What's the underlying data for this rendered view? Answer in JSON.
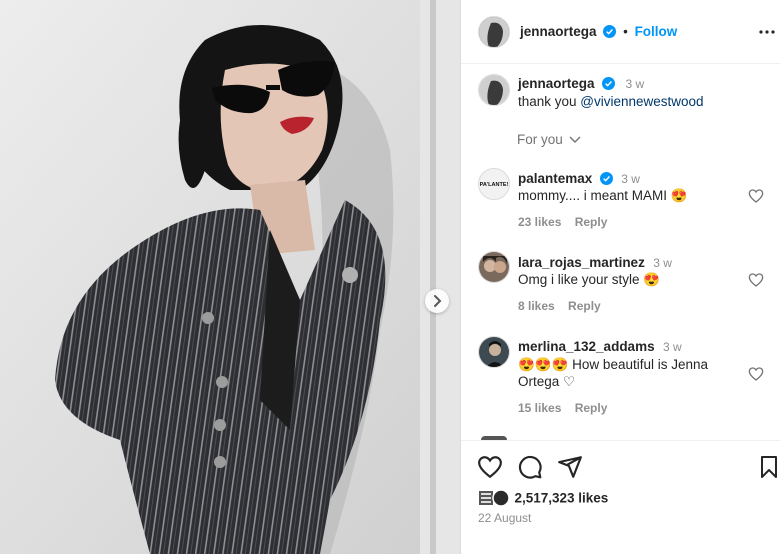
{
  "post": {
    "image_alt": "Woman in striped blazer and black sunglasses",
    "author": "jennaortega",
    "follow_label": "Follow",
    "dot": "•"
  },
  "caption": {
    "username": "jennaortega",
    "time": "3 w",
    "text": "thank you ",
    "mention": "@viviennewestwood"
  },
  "for_you_label": "For you",
  "comments": [
    {
      "username": "palantemax",
      "verified": true,
      "time": "3 w",
      "text": "mommy.... i meant MAMI 😍",
      "likes": "23 likes",
      "reply": "Reply"
    },
    {
      "username": "lara_rojas_martinez",
      "verified": false,
      "time": "3 w",
      "text": "Omg i like your style 😍",
      "likes": "8 likes",
      "reply": "Reply"
    },
    {
      "username": "merlina_132_addams",
      "verified": false,
      "time": "3 w",
      "text": "😍😍😍 How beautiful is Jenna Ortega ♡",
      "likes": "15 likes",
      "reply": "Reply"
    }
  ],
  "avatar1_text": "PA'LANTE!",
  "actions": {
    "likes": "2,517,323 likes",
    "date": "22 August"
  },
  "colors": {
    "link": "#0095f6",
    "verified": "#0095f6",
    "muted": "#8e8e8e"
  }
}
